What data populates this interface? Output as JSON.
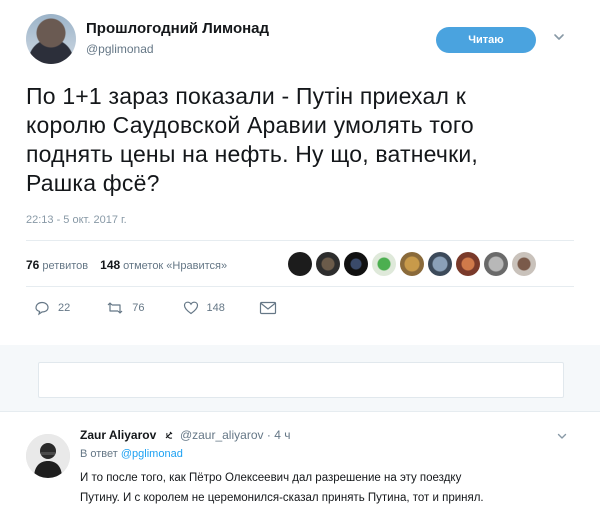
{
  "tweet": {
    "author_name": "Прошлогодний Лимонад",
    "author_handle": "@pglimonad",
    "follow_label": "Читаю",
    "text": "По 1+1 зараз показали - Путiн приехал к\nкоролю Саудовской Аравии умолять того\nподнять цены на нефть. Ну що, ватнечки,\nРашка фсё?",
    "timestamp": "22:13 - 5 окт. 2017 г.",
    "retweets_count": "76",
    "retweets_label": "ретвитов",
    "likes_count": "148",
    "likes_label": "отметок «Нравится»",
    "actions": {
      "reply_count": "22",
      "retweet_count": "76",
      "like_count": "148"
    }
  },
  "reply": {
    "author_name": "Zaur Aliyarov",
    "author_handle": "@zaur_aliyarov",
    "time": "4 ч",
    "reply_to_prefix": "В ответ",
    "reply_to_handle": "@pglimonad",
    "text": "И то после того, как Пётро Олексеевич дал разрешение на эту поездку\nПутину. И с королем не церемонился-сказал принять Путина, тот и принял."
  },
  "colors": {
    "accent": "#1da1f2",
    "follow_button": "#4aa3df",
    "muted": "#657786"
  },
  "icons": {
    "reply": "reply-icon",
    "retweet": "retweet-icon",
    "like": "heart-icon",
    "dm": "envelope-icon",
    "menu": "chevron-down-icon"
  }
}
